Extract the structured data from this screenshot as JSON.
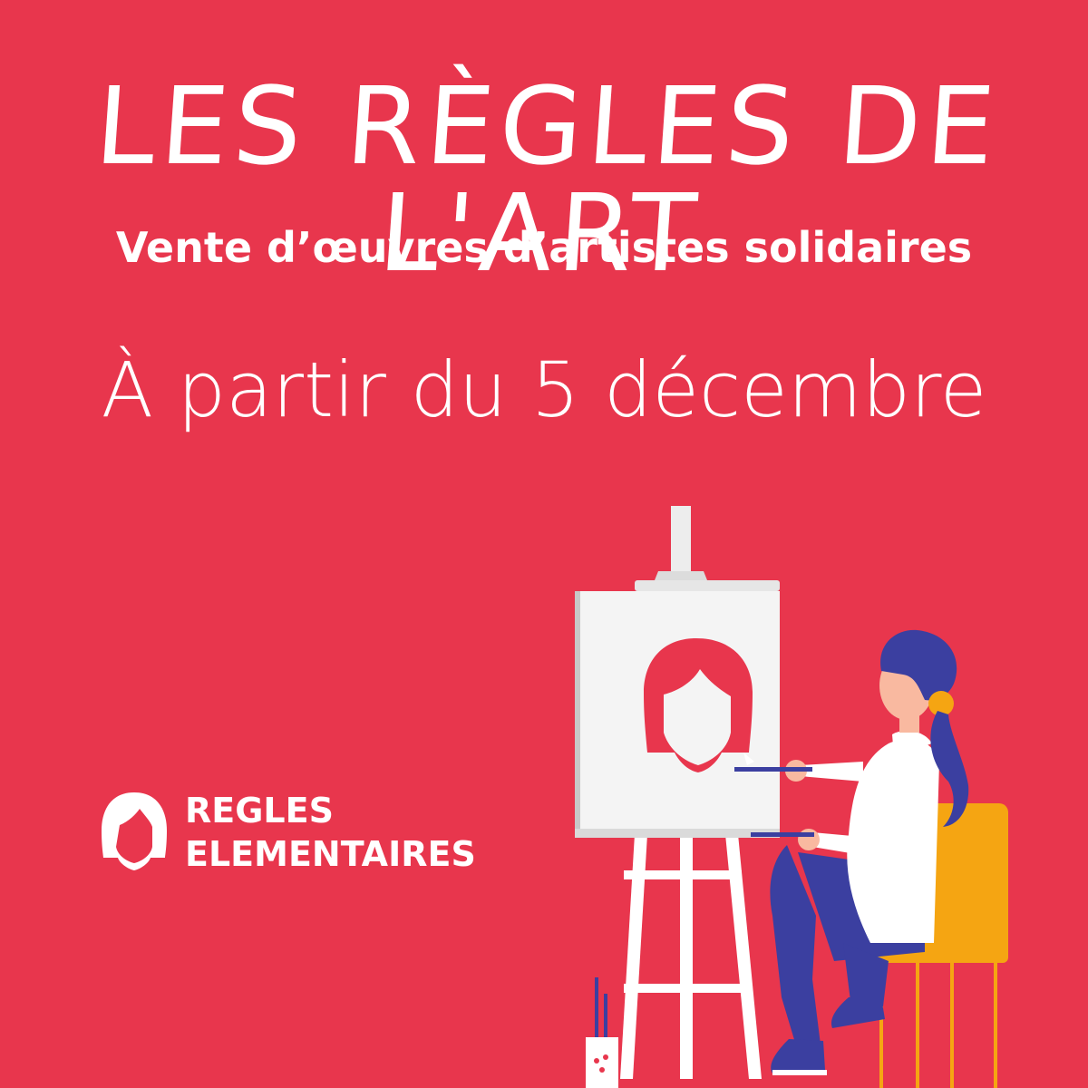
{
  "poster": {
    "title": "LES RÈGLES DE L'ART",
    "subtitle": "Vente d’œuvres d’artistes solidaires",
    "date": "À partir du 5 décembre"
  },
  "logo": {
    "line1": "REGLES",
    "line2": "ELEMENTAIRES",
    "icon": "woman-face-icon"
  },
  "colors": {
    "background": "#E8364D",
    "text": "#FFFFFF",
    "hair": "#3B3FA0",
    "chair": "#F5A512",
    "skin": "#F9B9A0"
  }
}
